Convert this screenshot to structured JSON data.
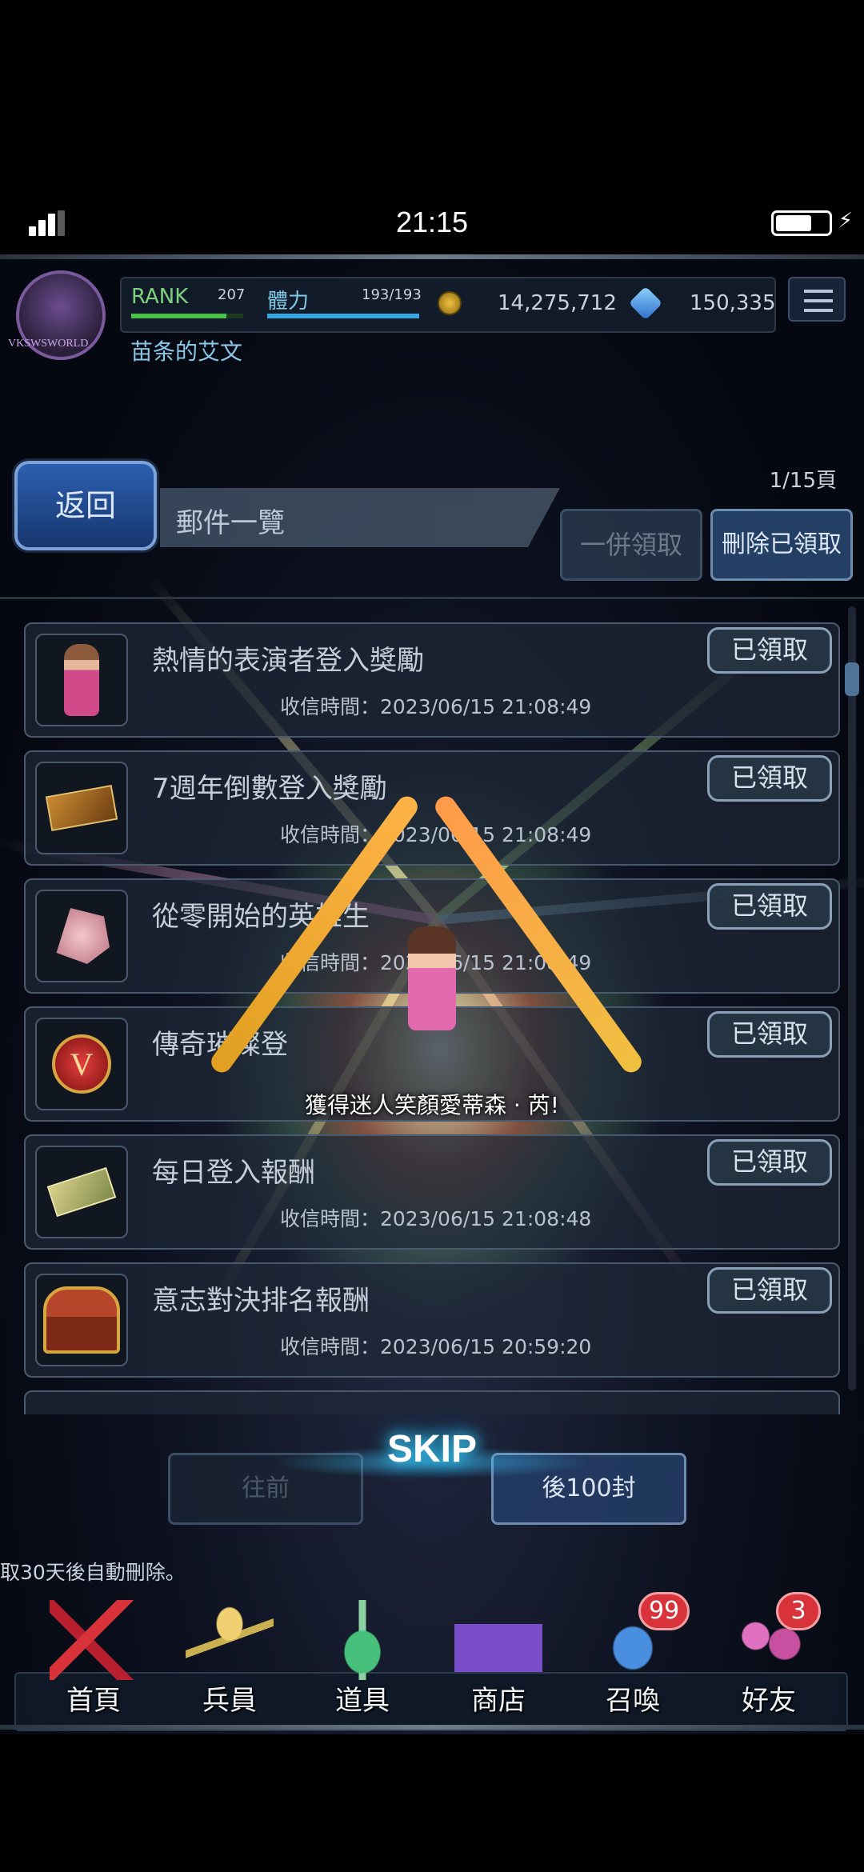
{
  "status_bar": {
    "time": "21:15"
  },
  "header": {
    "avatar_tag": "VKSWSWORLD",
    "rank_label": "RANK",
    "rank_value": "207",
    "rank_progress": 0.85,
    "stamina_label": "體力",
    "stamina_value": "193/193",
    "stamina_progress": 1.0,
    "gil": "14,275,712",
    "gems": "150,335",
    "player_name": "苗条的艾文"
  },
  "page": {
    "back_label": "返回",
    "title": "郵件一覽",
    "page_count": "1/15頁",
    "collect_all_label": "一併領取",
    "delete_claimed_label": "刪除已領取"
  },
  "mails": [
    {
      "title": "熱情的表演者登入獎勵",
      "date": "收信時間：2023/06/15 21:08:49",
      "status": "已領取",
      "icon": "character-sprite-icon"
    },
    {
      "title": "7週年倒數登入獎勵",
      "date": "收信時間：2023/06/15 21:08:49",
      "status": "已領取",
      "icon": "ticket-icon"
    },
    {
      "title": "從零開始的英雄生",
      "date": "收信時間：2023/06/15 21:08:49",
      "status": "已領取",
      "icon": "crystal-shard-icon"
    },
    {
      "title": "傳奇璀璨登",
      "date": "",
      "status": "已領取",
      "icon": "medal-icon"
    },
    {
      "title": "每日登入報酬",
      "date": "收信時間：2023/06/15 21:08:48",
      "status": "已領取",
      "icon": "voucher-icon"
    },
    {
      "title": "意志對決排名報酬",
      "date": "收信時間：2023/06/15 20:59:20",
      "status": "已領取",
      "icon": "treasure-chest-icon"
    }
  ],
  "overlay": {
    "skip_label": "SKIP",
    "obtain_text": "獲得迷人笑顏愛蒂森 · 芮!"
  },
  "pager": {
    "prev_label": "往前",
    "next_label": "後100封"
  },
  "footer_note": "取30天後自動刪除。",
  "nav": [
    {
      "label": "首頁",
      "icon": "swords-icon"
    },
    {
      "label": "兵員",
      "icon": "hero-icon"
    },
    {
      "label": "道具",
      "icon": "potion-icon"
    },
    {
      "label": "商店",
      "icon": "shop-icon"
    },
    {
      "label": "召喚",
      "icon": "summon-crystal-icon",
      "badge": "99"
    },
    {
      "label": "好友",
      "icon": "friends-icon",
      "badge": "3"
    }
  ],
  "colors": {
    "accent_blue": "#2c5fb0",
    "claimed_border": "#8aa1b8",
    "badge_red": "#d8323a",
    "skip_glow": "#3fd6ff"
  }
}
